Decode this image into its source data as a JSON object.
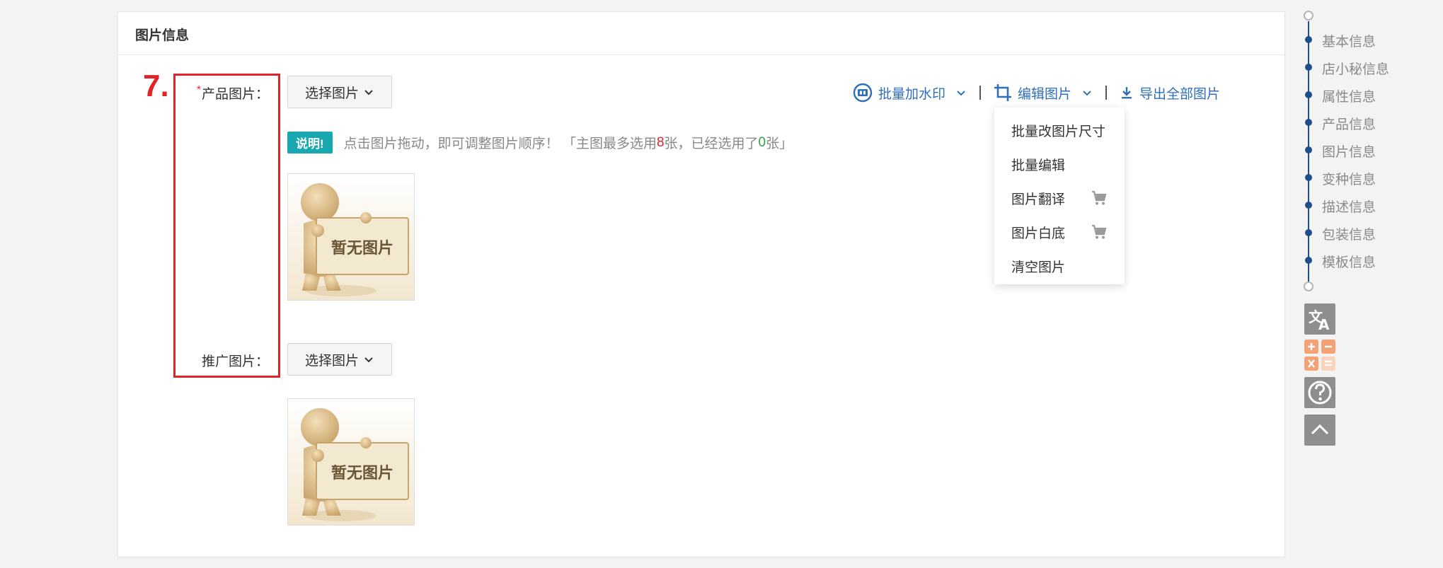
{
  "panel": {
    "title": "图片信息"
  },
  "annotation": {
    "number": "7."
  },
  "product_image": {
    "label": "产品图片：",
    "required_mark": "*",
    "select_button": "选择图片"
  },
  "promo_image": {
    "label": "推广图片：",
    "select_button": "选择图片"
  },
  "toolbar": {
    "watermark": "批量加水印",
    "edit_images": "编辑图片",
    "export_all": "导出全部图片"
  },
  "note": {
    "badge": "说明!",
    "text_a": "点击图片拖动，即可调整图片顺序！ 「主图最多选用",
    "max_count": "8",
    "text_b": "张，已经选用了",
    "used_count": "0",
    "text_c": "张」"
  },
  "placeholder": {
    "text": "暂无图片"
  },
  "edit_menu": {
    "items": [
      "批量改图片尺寸",
      "批量编辑",
      "图片翻译",
      "图片白底",
      "清空图片"
    ]
  },
  "side_nav": {
    "items": [
      "基本信息",
      "店小秘信息",
      "属性信息",
      "产品信息",
      "图片信息",
      "变种信息",
      "描述信息",
      "包装信息",
      "模板信息"
    ]
  },
  "colors": {
    "accent": "#2f6fb8",
    "annotation": "#e0242a",
    "badge": "#1aa8b0",
    "nav": "#1f4e8a"
  }
}
